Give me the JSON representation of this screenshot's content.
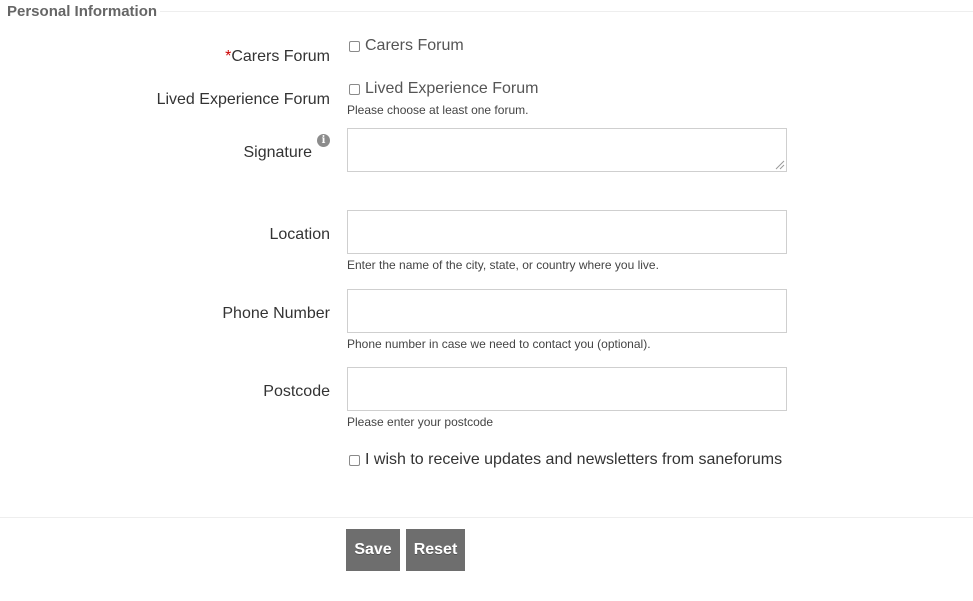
{
  "section": {
    "title": "Personal Information"
  },
  "fields": {
    "carers_forum": {
      "label": "Carers Forum",
      "required_mark": "*",
      "option_label": "Carers Forum",
      "checked": false
    },
    "lived_experience_forum": {
      "label": "Lived Experience Forum",
      "option_label": "Lived Experience Forum",
      "checked": false,
      "help": "Please choose at least one forum."
    },
    "signature": {
      "label": "Signature",
      "value": ""
    },
    "location": {
      "label": "Location",
      "value": "",
      "help": "Enter the name of the city, state, or country where you live."
    },
    "phone": {
      "label": "Phone Number",
      "value": "",
      "help": "Phone number in case we need to contact you (optional)."
    },
    "postcode": {
      "label": "Postcode",
      "value": "",
      "help": "Please enter your postcode"
    },
    "newsletter": {
      "label": "I wish to receive updates and newsletters from saneforums",
      "checked": false
    }
  },
  "buttons": {
    "save": "Save",
    "reset": "Reset"
  },
  "icons": {
    "signature_info": "info-icon"
  },
  "colors": {
    "required": "#cc0000",
    "button_bg": "#6e6e6e"
  }
}
